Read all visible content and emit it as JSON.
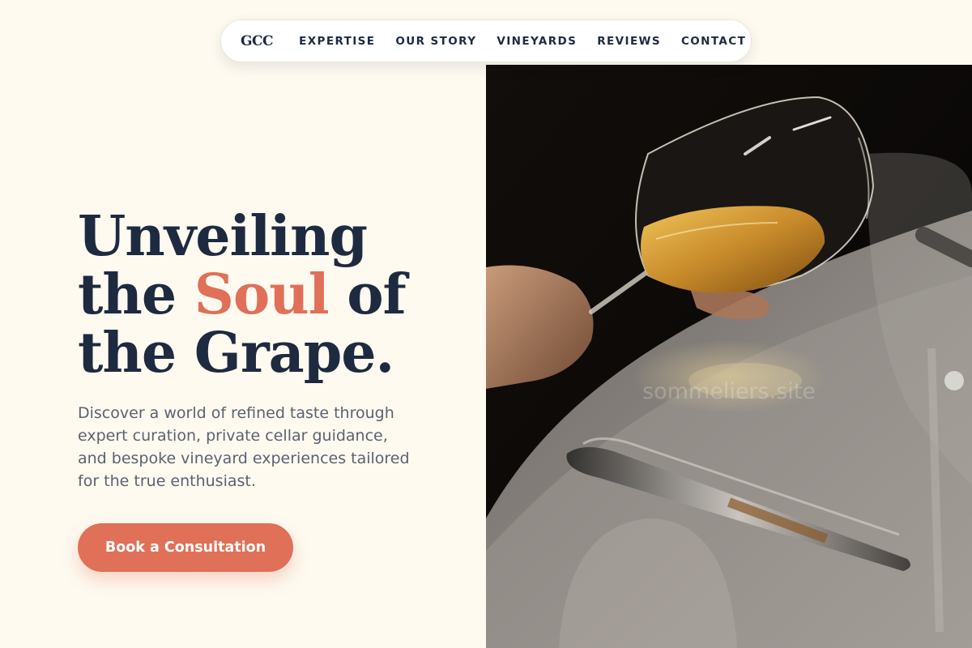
{
  "nav": {
    "logo": "GCC",
    "links": [
      "EXPERTISE",
      "OUR STORY",
      "VINEYARDS",
      "REVIEWS",
      "CONTACT"
    ]
  },
  "hero": {
    "title_line1": "Unveiling",
    "title_line2_pre": "the ",
    "title_accent": "Soul",
    "title_line2_post": " of",
    "title_line3": "the Grape.",
    "description": "Discover a world of refined taste through expert curation, private cellar guidance, and bespoke vineyard experiences tailored for the true enthusiast.",
    "cta_label": "Book a Consultation"
  },
  "image": {
    "watermark": "sommeliers.site"
  },
  "colors": {
    "background": "#fefaf0",
    "primary_text": "#1e2a40",
    "accent": "#e07057",
    "muted_text": "#5b6270"
  }
}
